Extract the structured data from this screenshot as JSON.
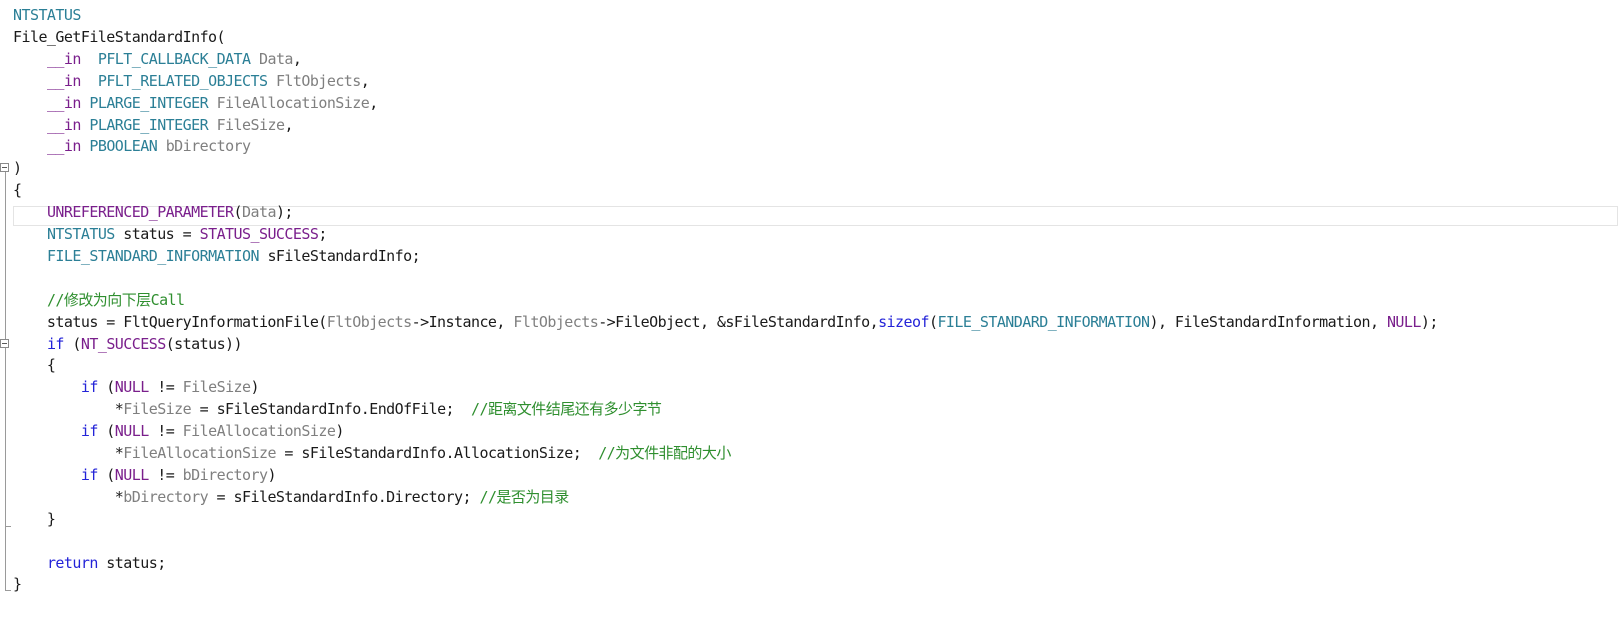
{
  "editor": {
    "lines": [
      {
        "id": "l1",
        "segments": [
          {
            "t": "NTSTATUS",
            "c": "type"
          }
        ]
      },
      {
        "id": "l2",
        "segments": [
          {
            "t": "File_GetFileStandardInfo(",
            "c": "plain"
          }
        ]
      },
      {
        "id": "l3",
        "segments": [
          {
            "t": "    ",
            "c": "plain"
          },
          {
            "t": "__in",
            "c": "macro"
          },
          {
            "t": "  ",
            "c": "plain"
          },
          {
            "t": "PFLT_CALLBACK_DATA",
            "c": "type"
          },
          {
            "t": " ",
            "c": "plain"
          },
          {
            "t": "Data",
            "c": "param"
          },
          {
            "t": ",",
            "c": "plain"
          }
        ]
      },
      {
        "id": "l4",
        "segments": [
          {
            "t": "    ",
            "c": "plain"
          },
          {
            "t": "__in",
            "c": "macro"
          },
          {
            "t": "  ",
            "c": "plain"
          },
          {
            "t": "PFLT_RELATED_OBJECTS",
            "c": "type"
          },
          {
            "t": " ",
            "c": "plain"
          },
          {
            "t": "FltObjects",
            "c": "param"
          },
          {
            "t": ",",
            "c": "plain"
          }
        ]
      },
      {
        "id": "l5",
        "segments": [
          {
            "t": "    ",
            "c": "plain"
          },
          {
            "t": "__in",
            "c": "macro"
          },
          {
            "t": " ",
            "c": "plain"
          },
          {
            "t": "PLARGE_INTEGER",
            "c": "type"
          },
          {
            "t": " ",
            "c": "plain"
          },
          {
            "t": "FileAllocationSize",
            "c": "param"
          },
          {
            "t": ",",
            "c": "plain"
          }
        ]
      },
      {
        "id": "l6",
        "segments": [
          {
            "t": "    ",
            "c": "plain"
          },
          {
            "t": "__in",
            "c": "macro"
          },
          {
            "t": " ",
            "c": "plain"
          },
          {
            "t": "PLARGE_INTEGER",
            "c": "type"
          },
          {
            "t": " ",
            "c": "plain"
          },
          {
            "t": "FileSize",
            "c": "param"
          },
          {
            "t": ",",
            "c": "plain"
          }
        ]
      },
      {
        "id": "l7",
        "segments": [
          {
            "t": "    ",
            "c": "plain"
          },
          {
            "t": "__in",
            "c": "macro"
          },
          {
            "t": " ",
            "c": "plain"
          },
          {
            "t": "PBOOLEAN",
            "c": "type"
          },
          {
            "t": " ",
            "c": "plain"
          },
          {
            "t": "bDirectory",
            "c": "param"
          }
        ]
      },
      {
        "id": "l8",
        "segments": [
          {
            "t": ")",
            "c": "plain"
          }
        ]
      },
      {
        "id": "l9",
        "segments": [
          {
            "t": "{",
            "c": "plain"
          }
        ]
      },
      {
        "id": "l10",
        "segments": [
          {
            "t": "    ",
            "c": "plain"
          },
          {
            "t": "UNREFERENCED_PARAMETER",
            "c": "macro"
          },
          {
            "t": "(",
            "c": "plain"
          },
          {
            "t": "Data",
            "c": "param"
          },
          {
            "t": ");",
            "c": "plain"
          }
        ]
      },
      {
        "id": "l11",
        "segments": [
          {
            "t": "    ",
            "c": "plain"
          },
          {
            "t": "NTSTATUS",
            "c": "type"
          },
          {
            "t": " status = ",
            "c": "plain"
          },
          {
            "t": "STATUS_SUCCESS",
            "c": "macro"
          },
          {
            "t": ";",
            "c": "plain"
          }
        ]
      },
      {
        "id": "l12",
        "segments": [
          {
            "t": "    ",
            "c": "plain"
          },
          {
            "t": "FILE_STANDARD_INFORMATION",
            "c": "type"
          },
          {
            "t": " sFileStandardInfo;",
            "c": "plain"
          }
        ]
      },
      {
        "id": "l13",
        "segments": [
          {
            "t": "",
            "c": "plain"
          }
        ]
      },
      {
        "id": "l14",
        "segments": [
          {
            "t": "    ",
            "c": "plain"
          },
          {
            "t": "//修改为向下层Call",
            "c": "com"
          }
        ]
      },
      {
        "id": "l15",
        "segments": [
          {
            "t": "    status = FltQueryInformationFile(",
            "c": "plain"
          },
          {
            "t": "FltObjects",
            "c": "param"
          },
          {
            "t": "->Instance, ",
            "c": "plain"
          },
          {
            "t": "FltObjects",
            "c": "param"
          },
          {
            "t": "->FileObject, &sFileStandardInfo,",
            "c": "plain"
          },
          {
            "t": "sizeof",
            "c": "kw"
          },
          {
            "t": "(",
            "c": "plain"
          },
          {
            "t": "FILE_STANDARD_INFORMATION",
            "c": "type"
          },
          {
            "t": "), FileStandardInformation, ",
            "c": "plain"
          },
          {
            "t": "NULL",
            "c": "macro"
          },
          {
            "t": ");",
            "c": "plain"
          }
        ]
      },
      {
        "id": "l16",
        "segments": [
          {
            "t": "    ",
            "c": "plain"
          },
          {
            "t": "if",
            "c": "kw"
          },
          {
            "t": " (",
            "c": "plain"
          },
          {
            "t": "NT_SUCCESS",
            "c": "macro"
          },
          {
            "t": "(status))",
            "c": "plain"
          }
        ]
      },
      {
        "id": "l17",
        "segments": [
          {
            "t": "    {",
            "c": "plain"
          }
        ]
      },
      {
        "id": "l18",
        "segments": [
          {
            "t": "        ",
            "c": "plain"
          },
          {
            "t": "if",
            "c": "kw"
          },
          {
            "t": " (",
            "c": "plain"
          },
          {
            "t": "NULL",
            "c": "macro"
          },
          {
            "t": " != ",
            "c": "plain"
          },
          {
            "t": "FileSize",
            "c": "param"
          },
          {
            "t": ")",
            "c": "plain"
          }
        ]
      },
      {
        "id": "l19",
        "segments": [
          {
            "t": "            *",
            "c": "plain"
          },
          {
            "t": "FileSize",
            "c": "param"
          },
          {
            "t": " = sFileStandardInfo.EndOfFile;  ",
            "c": "plain"
          },
          {
            "t": "//距离文件结尾还有多少字节",
            "c": "com"
          }
        ]
      },
      {
        "id": "l20",
        "segments": [
          {
            "t": "        ",
            "c": "plain"
          },
          {
            "t": "if",
            "c": "kw"
          },
          {
            "t": " (",
            "c": "plain"
          },
          {
            "t": "NULL",
            "c": "macro"
          },
          {
            "t": " != ",
            "c": "plain"
          },
          {
            "t": "FileAllocationSize",
            "c": "param"
          },
          {
            "t": ")",
            "c": "plain"
          }
        ]
      },
      {
        "id": "l21",
        "segments": [
          {
            "t": "            *",
            "c": "plain"
          },
          {
            "t": "FileAllocationSize",
            "c": "param"
          },
          {
            "t": " = sFileStandardInfo.AllocationSize;  ",
            "c": "plain"
          },
          {
            "t": "//为文件非配的大小",
            "c": "com"
          }
        ]
      },
      {
        "id": "l22",
        "segments": [
          {
            "t": "        ",
            "c": "plain"
          },
          {
            "t": "if",
            "c": "kw"
          },
          {
            "t": " (",
            "c": "plain"
          },
          {
            "t": "NULL",
            "c": "macro"
          },
          {
            "t": " != ",
            "c": "plain"
          },
          {
            "t": "bDirectory",
            "c": "param"
          },
          {
            "t": ")",
            "c": "plain"
          }
        ]
      },
      {
        "id": "l23",
        "segments": [
          {
            "t": "            *",
            "c": "plain"
          },
          {
            "t": "bDirectory",
            "c": "param"
          },
          {
            "t": " = sFileStandardInfo.Directory; ",
            "c": "plain"
          },
          {
            "t": "//是否为目录",
            "c": "com"
          }
        ]
      },
      {
        "id": "l24",
        "segments": [
          {
            "t": "    }",
            "c": "plain"
          }
        ]
      },
      {
        "id": "l25",
        "segments": [
          {
            "t": "",
            "c": "plain"
          }
        ]
      },
      {
        "id": "l26",
        "segments": [
          {
            "t": "    ",
            "c": "plain"
          },
          {
            "t": "return",
            "c": "kw"
          },
          {
            "t": " status;",
            "c": "plain"
          }
        ]
      },
      {
        "id": "l27",
        "segments": [
          {
            "t": "}",
            "c": "plain"
          }
        ]
      }
    ],
    "fold_markers": [
      {
        "symbol": "⊟"
      },
      {
        "symbol": "⊟"
      }
    ]
  }
}
